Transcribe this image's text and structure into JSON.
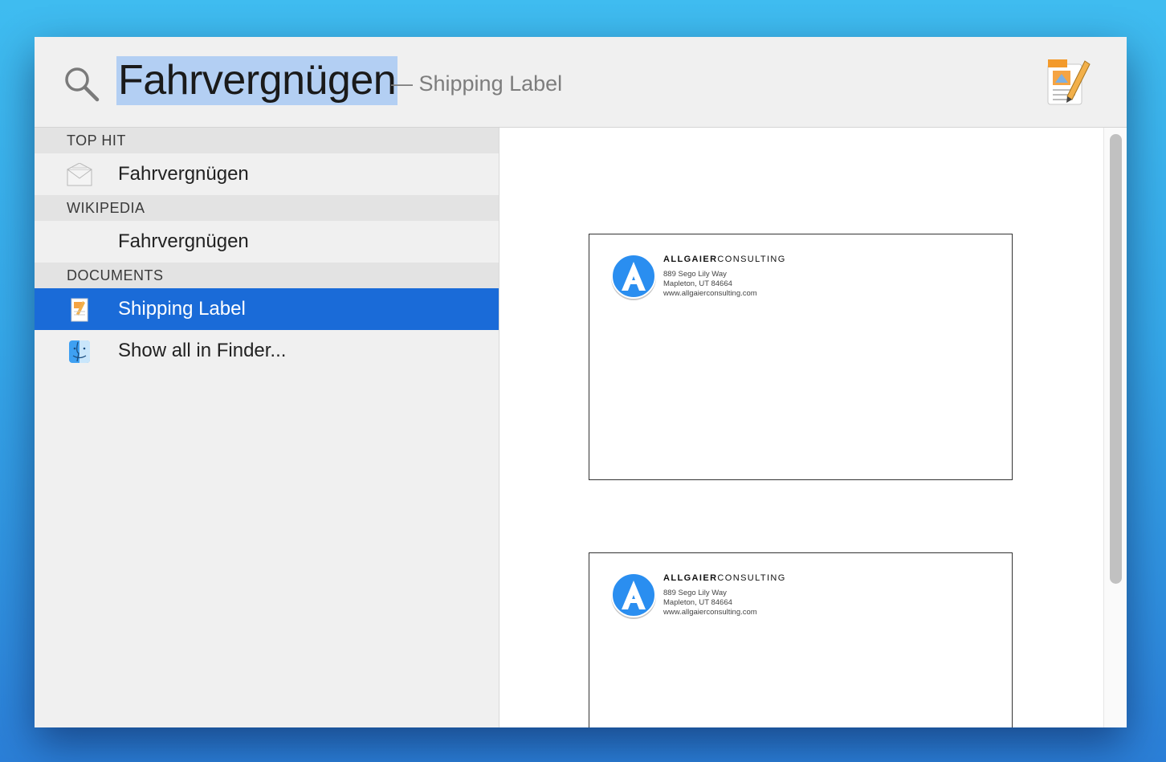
{
  "search": {
    "query": "Fahrvergnügen",
    "completion_hint": "— Shipping Label",
    "app_icon": "pages-icon"
  },
  "sidebar": {
    "sections": [
      {
        "header": "TOP HIT",
        "items": [
          {
            "label": "Fahrvergnügen",
            "icon": "envelope-icon"
          }
        ]
      },
      {
        "header": "WIKIPEDIA",
        "items": [
          {
            "label": "Fahrvergnügen",
            "icon": ""
          }
        ]
      },
      {
        "header": "DOCUMENTS",
        "items": [
          {
            "label": "Shipping Label",
            "icon": "pages-document-icon",
            "selected": true
          },
          {
            "label": "Show all in Finder...",
            "icon": "finder-icon"
          }
        ]
      }
    ]
  },
  "preview": {
    "labels": [
      {
        "company_bold": "ALLGAIER",
        "company_rest": "CONSULTING",
        "address_line1": "889 Sego Lily Way",
        "address_line2": "Mapleton, UT  84664",
        "website": "www.allgaierconsulting.com"
      },
      {
        "company_bold": "ALLGAIER",
        "company_rest": "CONSULTING",
        "address_line1": "889 Sego Lily Way",
        "address_line2": "Mapleton, UT  84664",
        "website": "www.allgaierconsulting.com"
      }
    ]
  },
  "colors": {
    "selection": "#1a6bd8",
    "query_highlight": "#b3cff3",
    "logo_blue": "#2a8ef0"
  }
}
